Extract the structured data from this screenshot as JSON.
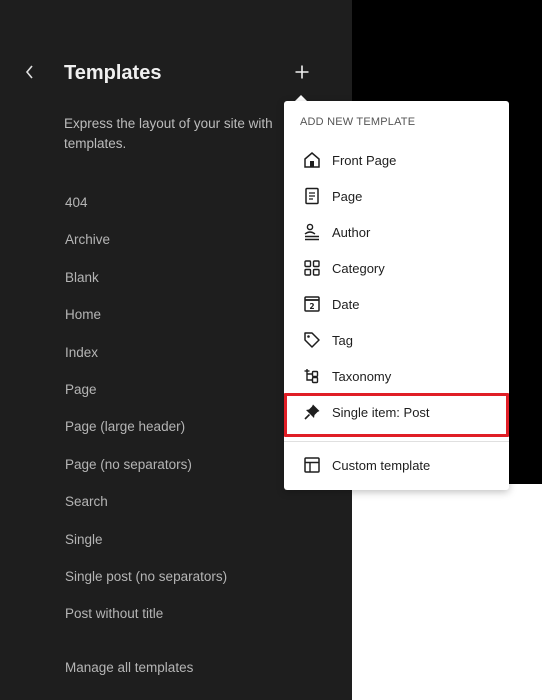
{
  "sidebar": {
    "title": "Templates",
    "description": "Express the layout of your site with templates.",
    "templates": [
      "404",
      "Archive",
      "Blank",
      "Home",
      "Index",
      "Page",
      "Page (large header)",
      "Page (no separators)",
      "Search",
      "Single",
      "Single post (no separators)",
      "Post without title"
    ],
    "manage_link": "Manage all templates"
  },
  "dropdown": {
    "heading": "ADD NEW TEMPLATE",
    "items": [
      {
        "label": "Front Page",
        "icon": "home-icon"
      },
      {
        "label": "Page",
        "icon": "page-icon"
      },
      {
        "label": "Author",
        "icon": "author-icon"
      },
      {
        "label": "Category",
        "icon": "category-icon"
      },
      {
        "label": "Date",
        "icon": "date-icon"
      },
      {
        "label": "Tag",
        "icon": "tag-icon"
      },
      {
        "label": "Taxonomy",
        "icon": "taxonomy-icon"
      },
      {
        "label": "Single item: Post",
        "icon": "pin-icon"
      }
    ],
    "custom": {
      "label": "Custom template",
      "icon": "layout-icon"
    }
  },
  "colors": {
    "sidebar_bg": "#1e1e1e",
    "highlight": "#e01e26"
  }
}
